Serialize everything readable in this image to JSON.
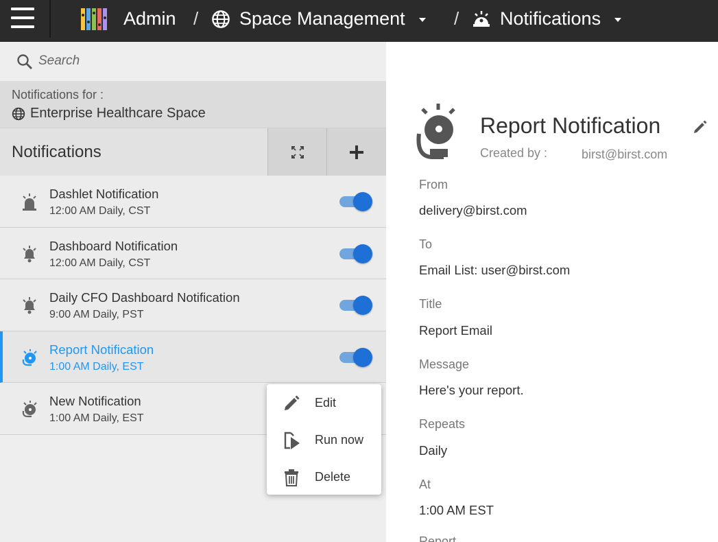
{
  "breadcrumb": {
    "admin": "Admin",
    "separator": "/",
    "space_management": "Space Management",
    "notifications": "Notifications"
  },
  "sidebar": {
    "search_placeholder": "Search",
    "notifications_for_label": "Notifications for :",
    "space_name": "Enterprise Healthcare Space",
    "section_title": "Notifications",
    "items": [
      {
        "name": "Dashlet Notification",
        "schedule": "12:00 AM Daily, CST",
        "icon": "siren-icon",
        "enabled": true
      },
      {
        "name": "Dashboard Notification",
        "schedule": "12:00 AM Daily, CST",
        "icon": "bell-icon",
        "enabled": true
      },
      {
        "name": "Daily CFO Dashboard Notification",
        "schedule": "9:00 AM Daily, PST",
        "icon": "bell-icon",
        "enabled": true
      },
      {
        "name": "Report Notification",
        "schedule": "1:00 AM Daily, EST",
        "icon": "report-alarm-icon",
        "enabled": true
      },
      {
        "name": "New Notification",
        "schedule": "1:00 AM Daily, EST",
        "icon": "report-alarm-icon"
      }
    ]
  },
  "context_menu": {
    "edit": "Edit",
    "run_now": "Run now",
    "delete": "Delete"
  },
  "detail": {
    "title": "Report Notification",
    "created_by_label": "Created by :",
    "created_by_value": "birst@birst.com",
    "from_label": "From",
    "from_value": "delivery@birst.com",
    "to_label": "To",
    "to_value": "Email List: user@birst.com",
    "title_label": "Title",
    "title_value": "Report Email",
    "message_label": "Message",
    "message_value": "Here's your report.",
    "repeats_label": "Repeats",
    "repeats_value": "Daily",
    "at_label": "At",
    "at_value": "1:00 AM EST",
    "report_label": "Report"
  },
  "colors": {
    "topbar": "#2b2b2b",
    "accent": "#2196f3",
    "toggle_knob": "#1e6fd6",
    "toggle_track": "#6fa6e0"
  }
}
